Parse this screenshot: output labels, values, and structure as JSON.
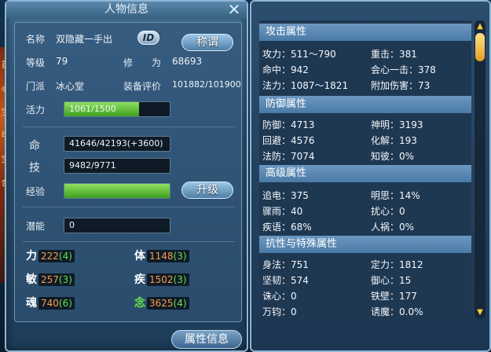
{
  "left_panel": {
    "title": "人物信息",
    "side_glyphs": [
      "首",
      "心",
      "宝",
      "甲",
      "宝",
      "合"
    ],
    "name_label": "名称",
    "name_value": "双隐藏一手出",
    "id_button": "ID",
    "title_button": "称谓",
    "level_label": "等级",
    "level_value": "79",
    "cultivation_label": "修　　为",
    "cultivation_value": "68693",
    "faction_label": "门派",
    "faction_value": "冰心堂",
    "gear_label": "装备评价",
    "gear_value": "101882/101900",
    "vitality_label": "活力",
    "vitality_value": "1061/1500",
    "vitality_fill": 0.707,
    "hp_label": "命",
    "hp_value": "41646/42193(+3600)",
    "skill_label": "技",
    "skill_value": "9482/9771",
    "exp_label": "经验",
    "exp_fill": 1.0,
    "upgrade_button": "升级",
    "potential_label": "潜能",
    "potential_value": "0",
    "attrs": [
      {
        "name": "力",
        "value": "222",
        "bonus": "(4)",
        "vcolor": "#ff9a48"
      },
      {
        "name": "体",
        "value": "1148",
        "bonus": "(3)",
        "vcolor": "#ff9a48"
      },
      {
        "name": "敏",
        "value": "257",
        "bonus": "(3)",
        "vcolor": "#ff9a48"
      },
      {
        "name": "疾",
        "value": "1502",
        "bonus": "(3)",
        "vcolor": "#ff9a48"
      },
      {
        "name": "魂",
        "value": "740",
        "bonus": "(6)",
        "vcolor": "#ff9a48"
      },
      {
        "name": "念",
        "value": "3625",
        "bonus": "(4)",
        "vcolor": "#ff9a48",
        "ncolor": "#68e048"
      }
    ],
    "attr_info_button": "属性信息"
  },
  "right_panel": {
    "attack": {
      "title": "攻击属性",
      "rows": [
        [
          "攻力：511～790",
          "重击：381"
        ],
        [
          "命中：942",
          "会心一击：378"
        ],
        [
          "法力：1087～1821",
          "附加伤害：73"
        ]
      ]
    },
    "defense": {
      "title": "防御属性",
      "rows": [
        [
          "防御：4713",
          "神明：3193"
        ],
        [
          "回避：4576",
          "化解：193"
        ],
        [
          "法防：7074",
          "知彼：0%"
        ]
      ]
    },
    "advanced": {
      "title": "高级属性",
      "rows": [
        [
          "追电：375",
          "明思：14%"
        ],
        [
          "骤雨：40",
          "扰心：0"
        ],
        [
          "疾语：68%",
          "人祸：0%"
        ]
      ]
    },
    "special": {
      "title": "抗性与特殊属性",
      "rows": [
        [
          "身法：751",
          "定力：1812"
        ],
        [
          "坚韧：574",
          "御心：15"
        ],
        [
          "诛心：0",
          "铁壁：177"
        ],
        [
          "万钧：0",
          "诱魔：0.0%"
        ]
      ]
    }
  }
}
